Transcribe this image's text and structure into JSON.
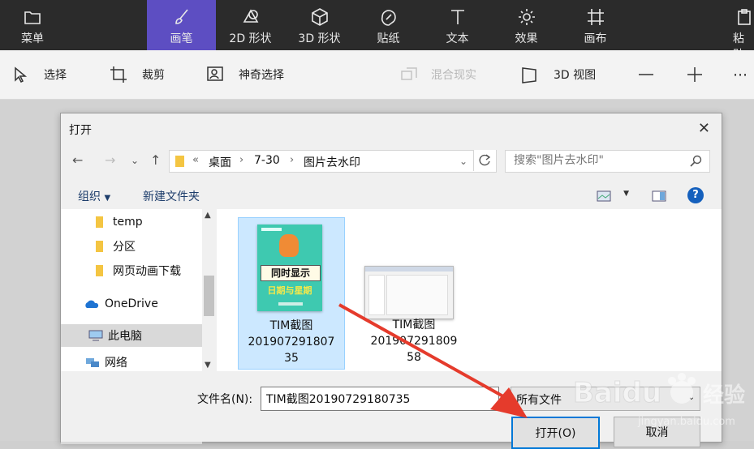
{
  "app_toolbar": {
    "menu_label": "菜单",
    "tabs": [
      {
        "label": "画笔",
        "icon": "brush-icon",
        "active": true
      },
      {
        "label": "2D 形状",
        "icon": "shapes-2d-icon"
      },
      {
        "label": "3D 形状",
        "icon": "cube-icon"
      },
      {
        "label": "贴纸",
        "icon": "sticker-icon"
      },
      {
        "label": "文本",
        "icon": "text-icon"
      },
      {
        "label": "效果",
        "icon": "sun-icon"
      },
      {
        "label": "画布",
        "icon": "canvas-icon"
      },
      {
        "label": "粘贴",
        "icon": "paste-icon"
      }
    ]
  },
  "tools": {
    "select": "选择",
    "crop": "裁剪",
    "magic_select": "神奇选择",
    "mixed_reality": "混合现实",
    "view_3d": "3D 视图"
  },
  "dialog": {
    "title": "打开",
    "address": {
      "folder1": "桌面",
      "folder2": "7-30",
      "folder3": "图片去水印"
    },
    "search_placeholder": "搜索\"图片去水印\"",
    "organize": "组织",
    "new_folder": "新建文件夹",
    "nav_items": [
      "temp",
      "分区",
      "网页动画下载",
      "OneDrive",
      "此电脑",
      "网络"
    ],
    "files": [
      {
        "name": "TIM截图20190729180735",
        "line1": "TIM截图",
        "line2": "201907291807",
        "line3": "35",
        "selected": true,
        "thumb": {
          "top": "同时显示",
          "bottom": "日期与星期",
          "bg": "#3ec9b0",
          "text": "#f5e84a"
        }
      },
      {
        "name": "TIM截图20190729180958",
        "line1": "TIM截图",
        "line2": "201907291809",
        "line3": "58",
        "selected": false
      }
    ],
    "filename_label": "文件名(N):",
    "filename_value": "TIM截图20190729180735",
    "filetype_value": "所有文件",
    "open_button": "打开(O)",
    "cancel_button": "取消"
  },
  "colors": {
    "accent": "#5d4ec2",
    "arrow": "#e53b2c"
  },
  "watermark": {
    "brand": "Baidu",
    "sub": "经验",
    "url": "jingyan.baidu.com"
  }
}
